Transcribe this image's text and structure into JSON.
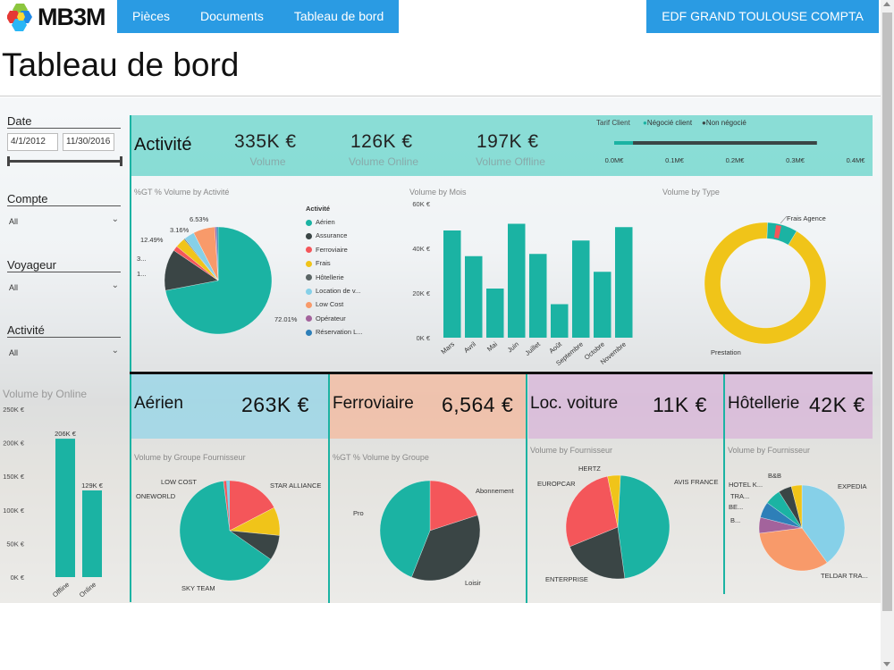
{
  "app": {
    "logo_text": "MB3M",
    "org_button": "EDF GRAND TOULOUSE COMPTA"
  },
  "nav": {
    "items": [
      "Pièces",
      "Documents",
      "Tableau de bord"
    ]
  },
  "page": {
    "title": "Tableau de bord"
  },
  "slicers": {
    "date_label": "Date",
    "date_from": "4/1/2012",
    "date_to": "11/30/2016",
    "compte_label": "Compte",
    "compte_value": "All",
    "voyageur_label": "Voyageur",
    "voyageur_value": "All",
    "activite_label": "Activité",
    "activite_value": "All"
  },
  "kpi": {
    "title": "Activité",
    "volume": "335K €",
    "volume_label": "Volume",
    "volume_online": "126K €",
    "volume_online_label": "Volume Online",
    "volume_offline": "197K €",
    "volume_offline_label": "Volume Offline"
  },
  "tarif": {
    "title": "Tarif Client",
    "legend_1": "Négocié client",
    "legend_2": "Non négocié",
    "ticks": [
      "0.0M€",
      "0.1M€",
      "0.2M€",
      "0.3M€",
      "0.4M€"
    ],
    "negocie_value": 0.006,
    "non_negocie_value": 0.33,
    "max": 0.4
  },
  "colors": {
    "teal": "#1bb3a3",
    "dark": "#3a4545",
    "red": "#f4565a",
    "yellow": "#f0c419",
    "grey": "#5a6565",
    "lightblue": "#86d0e8",
    "orange": "#f89a6a",
    "purple": "#a3639c",
    "blue": "#2e7fb8",
    "nav_blue": "#2a9be3"
  },
  "charts": {
    "activite_pie": {
      "title": "%GT % Volume by Activité",
      "legend_title": "Activité",
      "legend": [
        "Aérien",
        "Assurance",
        "Ferroviaire",
        "Frais",
        "Hôtellerie",
        "Location de v...",
        "Low Cost",
        "Opérateur",
        "Réservation L..."
      ],
      "labels": [
        "6.53%",
        "3.16%",
        "12.49%",
        "3...",
        "1...",
        "72.01%"
      ]
    },
    "volume_mois": {
      "title": "Volume by Mois"
    },
    "volume_type": {
      "title": "Volume by Type",
      "labels": [
        "Frais Agence",
        "Prestation"
      ]
    },
    "volume_online": {
      "title": "Volume by Online"
    },
    "aerien": {
      "name": "Aérien",
      "value": "263K €",
      "title": "Volume by Groupe Fournisseur",
      "labels": [
        "LOW COST",
        "ONEWORLD",
        "STAR ALLIANCE",
        "SKY TEAM"
      ]
    },
    "ferroviaire": {
      "name": "Ferroviaire",
      "value": "6,564 €",
      "title": "%GT % Volume by Groupe",
      "labels": [
        "Abonnement",
        "Pro",
        "Loisir"
      ]
    },
    "loc_voiture": {
      "name": "Loc. voiture",
      "value": "11K €",
      "title": "Volume by Fournisseur",
      "labels": [
        "HERTZ",
        "EUROPCAR",
        "AVIS FRANCE",
        "ENTERPRISE"
      ]
    },
    "hotellerie": {
      "name": "Hôtellerie",
      "value": "42K €",
      "title": "Volume by Fournisseur",
      "labels": [
        "B&B",
        "HOTEL K...",
        "TRA...",
        "BE...",
        "B...",
        "EXPEDIA",
        "TELDAR TRA..."
      ]
    }
  },
  "chart_data": [
    {
      "type": "pie",
      "title": "%GT % Volume by Activité",
      "categories": [
        "Aérien",
        "Assurance",
        "Ferroviaire",
        "Frais",
        "Hôtellerie",
        "Location de v...",
        "Low Cost",
        "Opérateur",
        "Réservation L..."
      ],
      "values": [
        72.01,
        12.49,
        1.5,
        3.0,
        0.3,
        3.16,
        6.53,
        0.5,
        0.51
      ]
    },
    {
      "type": "bar",
      "title": "Volume by Mois",
      "categories": [
        "Mars",
        "Avril",
        "Mai",
        "Juin",
        "Juillet",
        "Août",
        "Septembre",
        "Octobre",
        "Novembre"
      ],
      "values": [
        48000,
        36500,
        22000,
        51000,
        37500,
        15000,
        43500,
        29500,
        49500
      ],
      "yticks": [
        "0K €",
        "20K €",
        "40K €",
        "60K €"
      ],
      "ylim": [
        0,
        60000
      ]
    },
    {
      "type": "pie",
      "title": "Volume by Type",
      "categories": [
        "Prestation",
        "Frais Agence"
      ],
      "values": [
        92,
        8
      ]
    },
    {
      "type": "bar",
      "title": "Volume by Online",
      "categories": [
        "Offline",
        "Online"
      ],
      "values": [
        206000,
        129000
      ],
      "data_labels": [
        "206K €",
        "129K €"
      ],
      "yticks": [
        "0K €",
        "50K €",
        "100K €",
        "150K €",
        "200K €",
        "250K €"
      ],
      "ylim": [
        0,
        250000
      ]
    },
    {
      "type": "pie",
      "title": "Volume by Groupe Fournisseur",
      "categories": [
        "SKY TEAM",
        "STAR ALLIANCE",
        "LOW COST",
        "ONEWORLD"
      ],
      "values": [
        62,
        19,
        9,
        8
      ]
    },
    {
      "type": "pie",
      "title": "%GT % Volume by Groupe",
      "categories": [
        "Abonnement",
        "Loisir",
        "Pro"
      ],
      "values": [
        20,
        36,
        44
      ]
    },
    {
      "type": "pie",
      "title": "Volume by Fournisseur",
      "categories": [
        "AVIS FRANCE",
        "ENTERPRISE",
        "EUROPCAR",
        "HERTZ"
      ],
      "values": [
        47,
        21,
        28,
        4
      ]
    },
    {
      "type": "pie",
      "title": "Volume by Fournisseur",
      "categories": [
        "EXPEDIA",
        "TELDAR TRA...",
        "B...",
        "BE...",
        "TRA...",
        "HOTEL K...",
        "B&B"
      ],
      "values": [
        40,
        33,
        6,
        6,
        6,
        5,
        4
      ]
    }
  ]
}
